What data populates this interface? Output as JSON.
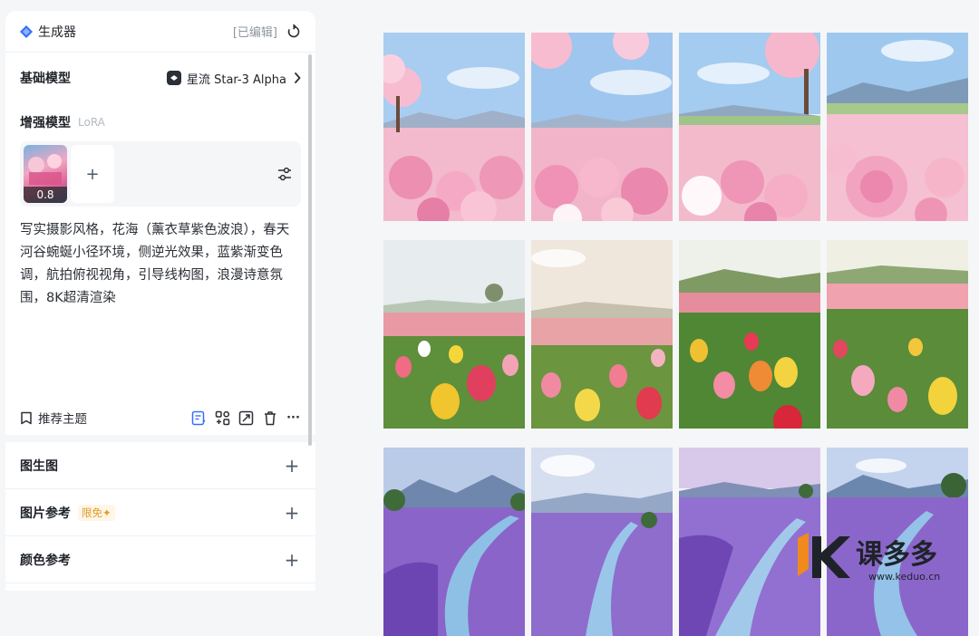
{
  "panel": {
    "title": "生成器",
    "edited": "[已编辑]",
    "base_model_label": "基础模型",
    "model_name": "星流 Star-3 Alpha",
    "enhance_label": "增强模型",
    "lora_tag": "LoRA",
    "lora_strength": "0.8",
    "add_symbol": "+",
    "prompt": "写实摄影风格，花海（薰衣草紫色波浪），春天河谷蜿蜒小径环境，侧逆光效果，蓝紫渐变色调，航拍俯视视角，引导线构图，浪漫诗意氛围，8K超清渲染",
    "recommend": "推荐主题",
    "more": "···",
    "sections": [
      {
        "label": "图生图"
      },
      {
        "label": "图片参考",
        "badge": "限免✦"
      },
      {
        "label": "颜色参考"
      }
    ]
  },
  "gallery": {
    "rows": [
      "cherry-blossom-peony",
      "tulip-field",
      "lavender-river"
    ],
    "columns": 4
  },
  "watermark": {
    "brand": "课多多",
    "url": "www.keduo.cn"
  },
  "colors": {
    "accent": "#3370ff",
    "badge": "#e09b2d"
  }
}
